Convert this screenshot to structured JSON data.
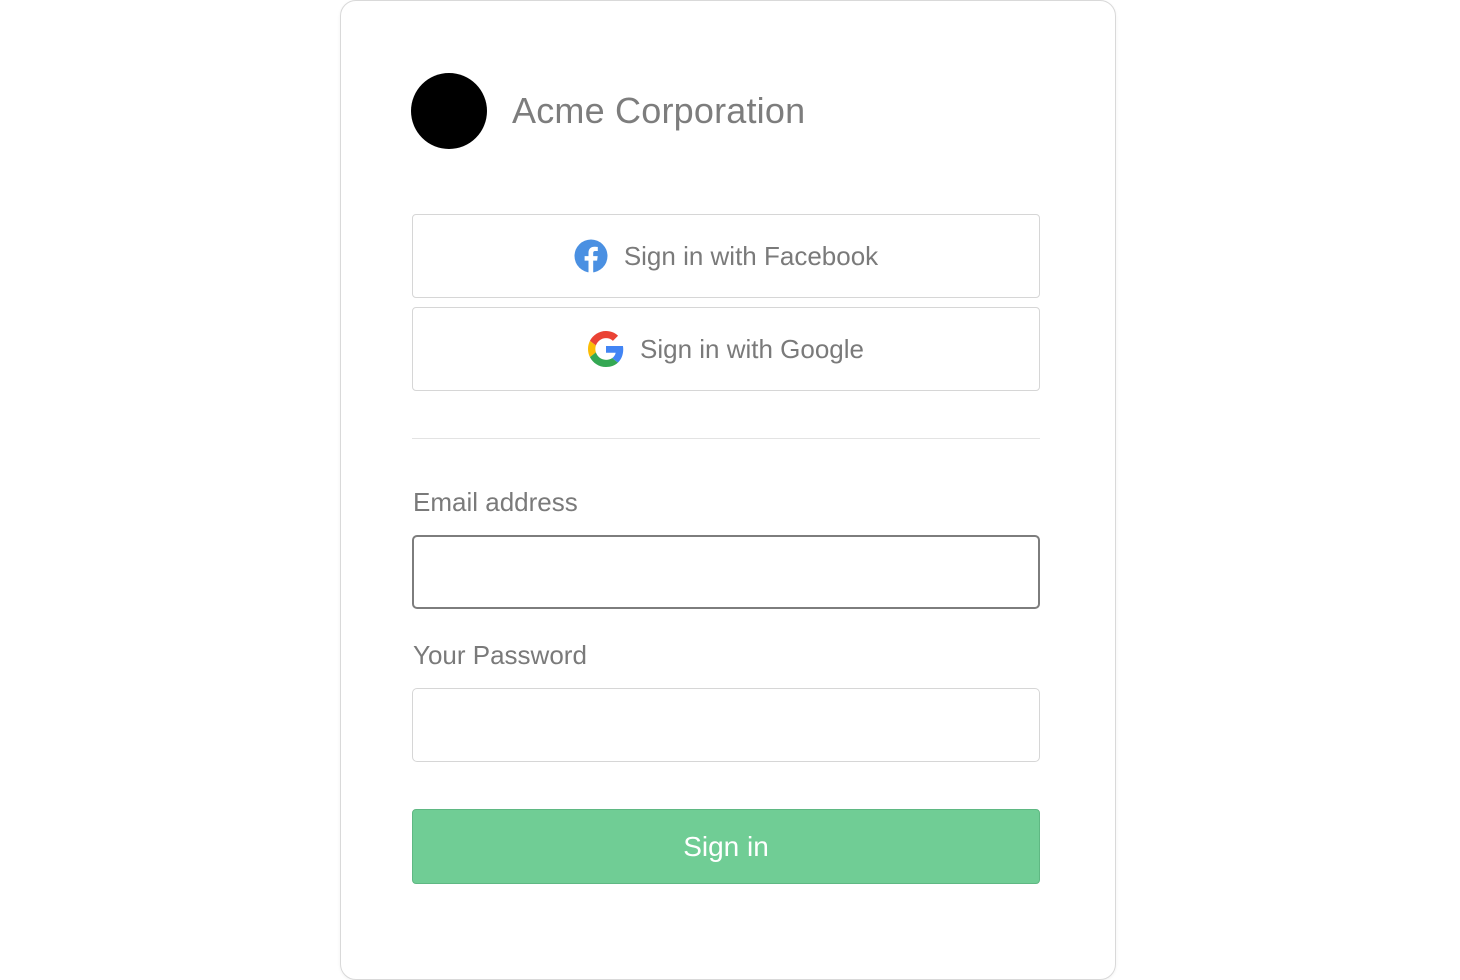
{
  "brand": {
    "name": "Acme Corporation",
    "logo_color": "#000000"
  },
  "social": {
    "facebook": {
      "label": "Sign in with Facebook",
      "icon": "facebook-icon",
      "icon_color": "#4a90e2"
    },
    "google": {
      "label": "Sign in with Google",
      "icon": "google-icon"
    }
  },
  "form": {
    "email": {
      "label": "Email address",
      "value": "",
      "placeholder": ""
    },
    "password": {
      "label": "Your Password",
      "value": "",
      "placeholder": ""
    },
    "submit_label": "Sign in",
    "submit_color": "#70cd95"
  }
}
